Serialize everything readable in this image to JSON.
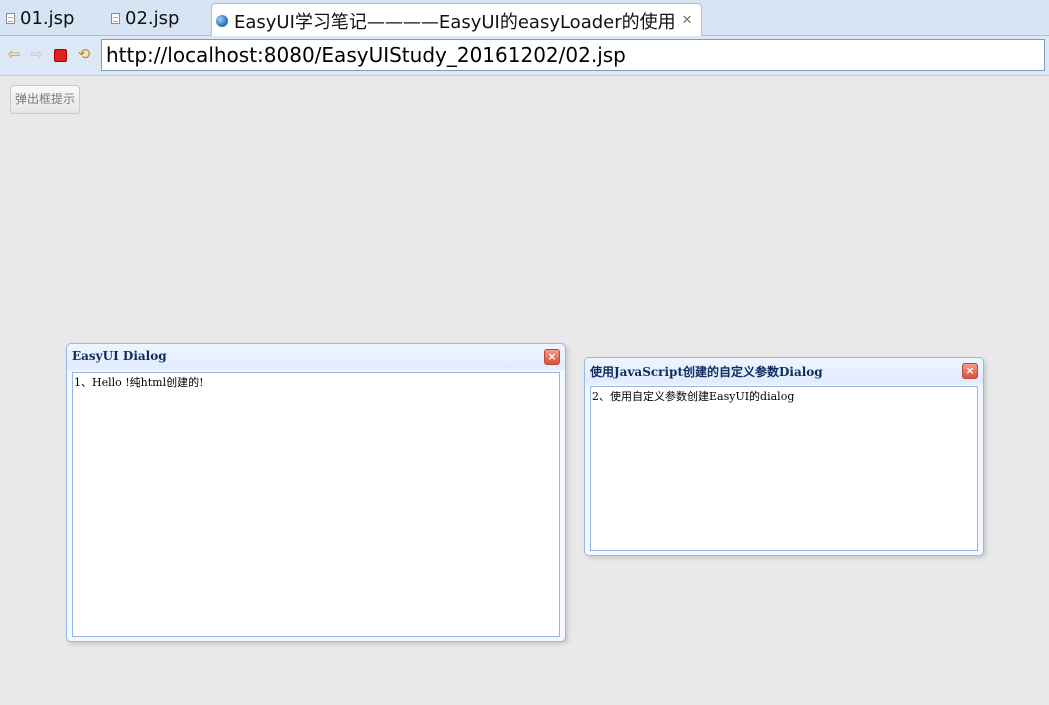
{
  "tabs": [
    {
      "label": "01.jsp",
      "icon": "file-icon"
    },
    {
      "label": "02.jsp",
      "icon": "file-icon"
    },
    {
      "label": "EasyUI学习笔记————EasyUI的easyLoader的使用",
      "icon": "globe-icon",
      "close": "✕"
    }
  ],
  "toolbar": {
    "back_icon": "⇦",
    "forward_icon": "⇨",
    "refresh_icon": "⟲",
    "url": "http://localhost:8080/EasyUIStudy_20161202/02.jsp"
  },
  "page": {
    "popup_button_label": "弹出框提示"
  },
  "dialogs": [
    {
      "title": "EasyUI Dialog",
      "content": "1、Hello !纯html创建的!",
      "close": "×"
    },
    {
      "title": "使用JavaScript创建的自定义参数Dialog",
      "content": "2、使用自定义参数创建EasyUI的dialog",
      "close": "×"
    }
  ]
}
